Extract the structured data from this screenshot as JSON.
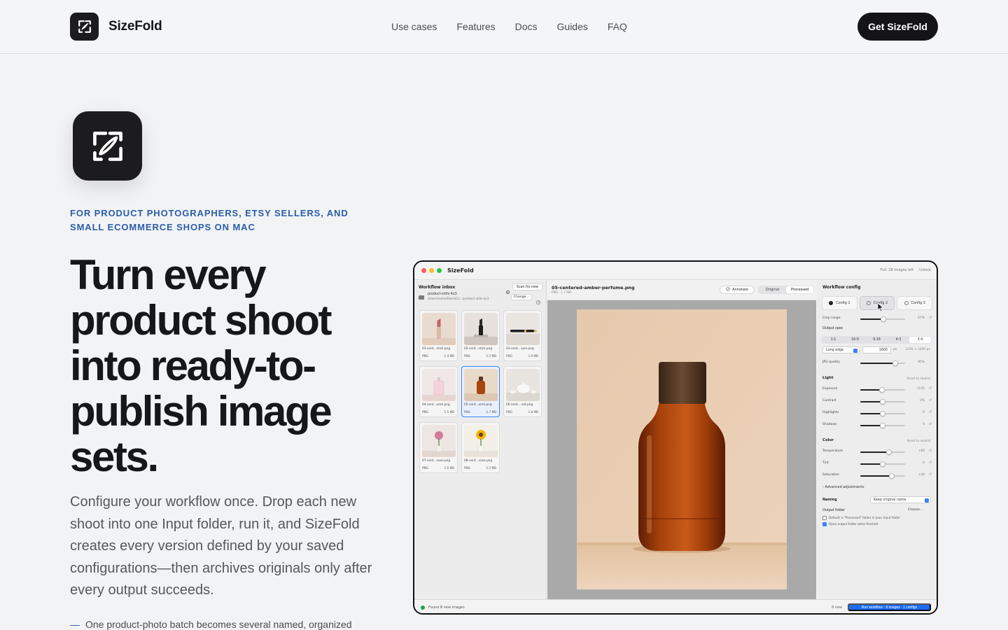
{
  "brand": {
    "name": "SizeFold"
  },
  "nav": {
    "items": [
      "Use cases",
      "Features",
      "Docs",
      "Guides",
      "FAQ"
    ]
  },
  "header": {
    "cta_label": "Get SizeFold"
  },
  "hero": {
    "eyebrow": "For product photographers, Etsy sellers, and small ecommerce shops on Mac",
    "headline": "Turn every product shoot into ready-to-publish image sets.",
    "subcopy": "Configure your workflow once. Drop each new shoot into one Input folder, run it, and SizeFold creates every version defined by your saved configurations—then archives originals only after every output succeeds.",
    "bullet": "One product-photo batch becomes several named, organized"
  },
  "app": {
    "title": "SizeFold",
    "top_right": {
      "status": "Full: 28 images left",
      "unlock": "Unlock"
    },
    "inbox": {
      "title": "Workflow inbox",
      "scan_label": "Scan for new",
      "folder_name": "product-stills-4x3",
      "folder_path": "/Users/name/HomeCo.../product-stills-4x3",
      "change_label": "Change…",
      "images": [
        {
          "name": "01-cent...stick.png",
          "type": "PNG",
          "size": "1.4 MB"
        },
        {
          "name": "02-cent...stick.png",
          "type": "PNG",
          "size": "1.5 MB"
        },
        {
          "name": "03-cent...-pen.png",
          "type": "PNG",
          "size": "1.9 MB"
        },
        {
          "name": "04-cent...ume.png",
          "type": "PNG",
          "size": "1.5 MB"
        },
        {
          "name": "05-cent...ume.png",
          "type": "PNG",
          "size": "1.7 MB"
        },
        {
          "name": "06-cent...-set.png",
          "type": "PNG",
          "size": "1.8 MB"
        },
        {
          "name": "07-cent...vase.png",
          "type": "PNG",
          "size": "1.6 MB"
        },
        {
          "name": "08-cent...vase.png",
          "type": "PNG",
          "size": "1.5 MB"
        }
      ]
    },
    "preview": {
      "file_title": "05-centered-amber-perfume.png",
      "file_meta": "PNG · 1.7 MB",
      "annotate_label": "Annotate",
      "view_original": "Original",
      "view_processed": "Processed"
    },
    "config": {
      "title": "Workflow config",
      "tabs": [
        "Config 1",
        "Config 2",
        "Config 3"
      ],
      "crop_label": "Crop range",
      "crop_value": "67%",
      "crop_level": 0.52,
      "output_spec_label": "Output spec",
      "ratios": [
        "1:1",
        "16:9",
        "9:16",
        "4:3",
        "3:4"
      ],
      "edge_label": "Long edge",
      "edge_value": "1600",
      "edge_unit": "px",
      "edge_dims": "1200 × 1600 px",
      "jpg_label": "JPG quality",
      "jpg_value": "95%",
      "jpg_level": 0.78,
      "light": {
        "title": "Light",
        "reset": "Reset to neutral",
        "rows": [
          {
            "label": "Exposure",
            "value": "-0.05",
            "level": 0.48
          },
          {
            "label": "Contrast",
            "value": "0%",
            "level": 0.5
          },
          {
            "label": "Highlights",
            "value": "0",
            "level": 0.5
          },
          {
            "label": "Shadows",
            "value": "0",
            "level": 0.5
          }
        ]
      },
      "color": {
        "title": "Color",
        "reset": "Reset to neutral",
        "rows": [
          {
            "label": "Temperature",
            "value": "+85",
            "level": 0.64
          },
          {
            "label": "Tint",
            "value": "0",
            "level": 0.5
          },
          {
            "label": "Saturation",
            "value": "+40",
            "level": 0.7
          }
        ]
      },
      "advanced_label": "Advanced adjustments",
      "naming_label": "Naming",
      "naming_value": "Keep original name",
      "output_folder_label": "Output folder",
      "choose_label": "Choose…",
      "default_option": "Default: a \"Processed\" folder in your input folder",
      "open_option": "Open output folder when finished"
    },
    "status": {
      "found_text": "Found 8 new images",
      "new_count": "8 new",
      "run_label": "Run workflow · 8 images · 1 configs"
    }
  },
  "colors": {
    "accent_blue": "#2a5ea8",
    "run_blue": "#1b6ef3",
    "dark": "#141417"
  },
  "icons": [
    "sizefold-logo-icon",
    "folder-icon",
    "gear-icon",
    "annotate-icon",
    "cursor-icon",
    "status-dot-icon"
  ]
}
